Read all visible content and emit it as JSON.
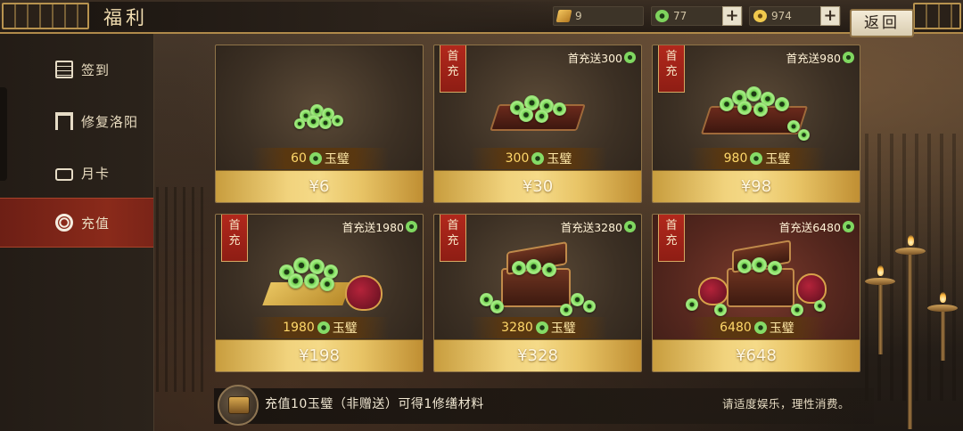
{
  "header": {
    "title": "福利",
    "back_label": "返回",
    "resources": [
      {
        "name": "ticket",
        "value": "9",
        "icon": "ticket-icon"
      },
      {
        "name": "jade",
        "value": "77",
        "icon": "jade-icon"
      },
      {
        "name": "gold",
        "value": "974",
        "icon": "gold-coin-icon"
      }
    ]
  },
  "sidebar": {
    "items": [
      {
        "label": "签到",
        "icon": "sign-in-icon"
      },
      {
        "label": "修复洛阳",
        "icon": "gate-icon"
      },
      {
        "label": "月卡",
        "icon": "monthly-card-icon"
      },
      {
        "label": "充值",
        "icon": "recharge-icon",
        "active": true
      }
    ]
  },
  "products": [
    {
      "first_tag": "",
      "bonus": "",
      "amount": "60",
      "currency": "玉璧",
      "price": "¥6"
    },
    {
      "first_tag": "首充",
      "bonus": "首充送300",
      "amount": "300",
      "currency": "玉璧",
      "price": "¥30"
    },
    {
      "first_tag": "首充",
      "bonus": "首充送980",
      "amount": "980",
      "currency": "玉璧",
      "price": "¥98"
    },
    {
      "first_tag": "首充",
      "bonus": "首充送1980",
      "amount": "1980",
      "currency": "玉璧",
      "price": "¥198"
    },
    {
      "first_tag": "首充",
      "bonus": "首充送3280",
      "amount": "3280",
      "currency": "玉璧",
      "price": "¥328"
    },
    {
      "first_tag": "首充",
      "bonus": "首充送6480",
      "amount": "6480",
      "currency": "玉璧",
      "price": "¥648"
    }
  ],
  "footer": {
    "info": "充值10玉璧（非赠送）可得1修缮材料",
    "notice": "请适度娱乐，理性消费。"
  },
  "colors": {
    "active_tab": "#8a2a1a",
    "price_gold": "#f1d37d",
    "first_tag_red": "#b2281c",
    "jade_green": "#7fd760"
  }
}
